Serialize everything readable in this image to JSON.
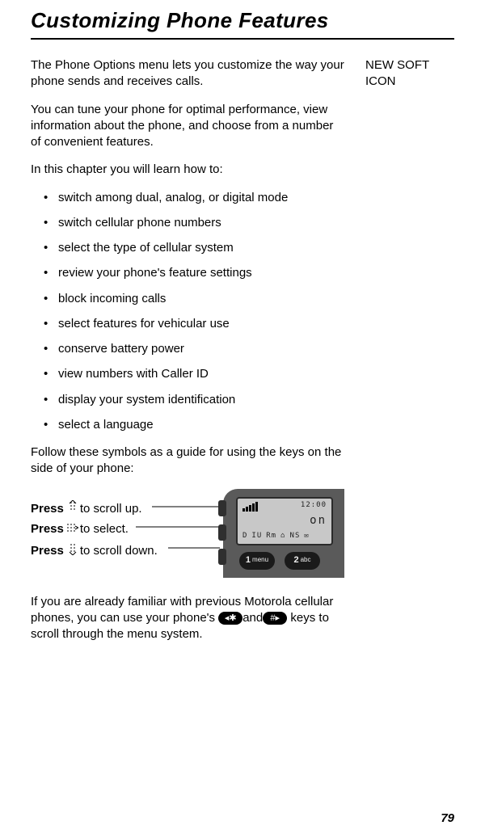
{
  "title": "Customizing Phone Features",
  "sideNote": "NEW SOFT ICON",
  "intro1": "The Phone Options menu lets you customize the way your phone sends and receives calls.",
  "intro2": "You can tune your phone for optimal performance, view information about the phone, and choose from a number of convenient features.",
  "intro3": "In this chapter you will learn how to:",
  "bullets": [
    "switch among dual, analog, or digital mode",
    "switch cellular phone numbers",
    "select the type of cellular system",
    "review your phone's feature settings",
    "block incoming calls",
    "select features for vehicular use",
    "conserve battery power",
    "view numbers with Caller ID",
    "display your system identification",
    "select a language"
  ],
  "follow": "Follow these symbols as a guide for using the keys on the side of your phone:",
  "press": {
    "label": "Press",
    "up": " to scroll up.",
    "select": " to select.",
    "down": " to scroll down."
  },
  "phone": {
    "time": "12:00",
    "on": "on",
    "status": [
      "D",
      "IU",
      "Rm",
      "NS"
    ],
    "key1num": "1",
    "key1sub": "menu",
    "key2num": "2",
    "key2sub": "abc"
  },
  "tail1a": "If you are already familiar with previous Motorola cellular phones, you can use your phone's ",
  "tail_starkey": "◂✱",
  "tail_and": "and",
  "tail_hashkey": "#▸",
  "tail1b": " keys to scroll through the menu system.",
  "pageNumber": "79"
}
